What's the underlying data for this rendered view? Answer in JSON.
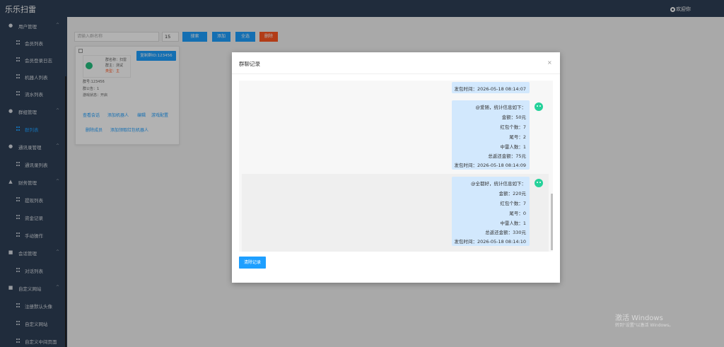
{
  "app": {
    "title": "乐乐扫雷",
    "user": "欢迎你"
  },
  "sidebar": {
    "items": [
      {
        "type": "group",
        "label": "用户管理",
        "icon": "user-icon"
      },
      {
        "type": "sub",
        "label": "会员列表"
      },
      {
        "type": "sub",
        "label": "会员登录日志"
      },
      {
        "type": "sub",
        "label": "机器人列表"
      },
      {
        "type": "sub",
        "label": "流水列表"
      },
      {
        "type": "group",
        "label": "群组管理",
        "icon": "group-icon"
      },
      {
        "type": "sub",
        "label": "群列表",
        "active": true
      },
      {
        "type": "group",
        "label": "通讯录管理",
        "icon": "contacts-icon"
      },
      {
        "type": "sub",
        "label": "通讯录列表"
      },
      {
        "type": "group",
        "label": "财务管理",
        "icon": "finance-icon"
      },
      {
        "type": "sub",
        "label": "提现列表"
      },
      {
        "type": "sub",
        "label": "资金记录"
      },
      {
        "type": "sub",
        "label": "手动操作"
      },
      {
        "type": "group",
        "label": "会话管理",
        "icon": "chat-icon"
      },
      {
        "type": "sub",
        "label": "对话列表"
      },
      {
        "type": "group",
        "label": "自定义网站",
        "icon": "site-icon"
      },
      {
        "type": "sub",
        "label": "注册默认头像"
      },
      {
        "type": "sub",
        "label": "自定义网站"
      },
      {
        "type": "sub",
        "label": "自定义中间页面"
      }
    ]
  },
  "toolbar": {
    "search_placeholder": "请输入群名称",
    "page_size": "15",
    "btn_search": "搜索",
    "btn_add": "添加",
    "btn_select_all": "全选",
    "btn_delete": "删除"
  },
  "card": {
    "id_button": "复制群ID:123456",
    "l1": "群名称：扫雷",
    "l2": "群主：测试",
    "l3": "类型：主",
    "l4": "群号:123456",
    "l5": "群公告：1",
    "l6": "游戏状态：开启",
    "links": [
      "查看会话",
      "添加机器人",
      "编辑",
      "游戏配置",
      "删除成员",
      "添加领取红包机器人"
    ]
  },
  "modal": {
    "title": "群聊记录",
    "close": "×",
    "clear_button": "清除记录",
    "messages": [
      {
        "lines": [
          "发包时间：2026-05-18 08:14:07"
        ]
      },
      {
        "lines": [
          "@爱随，统计信息如下：",
          "金额：50元",
          "红包个数：7",
          "尾号：2",
          "中雷人数：1",
          "总返还金额：75元",
          "发包时间：2026-05-18 08:14:09"
        ]
      },
      {
        "lines": [
          "@全都好，统计信息如下：",
          "金额：220元",
          "红包个数：7",
          "尾号：0",
          "中雷人数：1",
          "总返还金额：330元",
          "发包时间：2026-05-18 08:14:10"
        ]
      }
    ]
  },
  "watermark": {
    "line1": "激活 Windows",
    "line2": "转到\"设置\"以激活 Windows。"
  },
  "colors": {
    "sidebar": "#2f4056",
    "accent": "#1e9fff",
    "danger": "#ff5722",
    "bubble": "#d2e8fd",
    "bot_avatar": "#25d19a"
  }
}
